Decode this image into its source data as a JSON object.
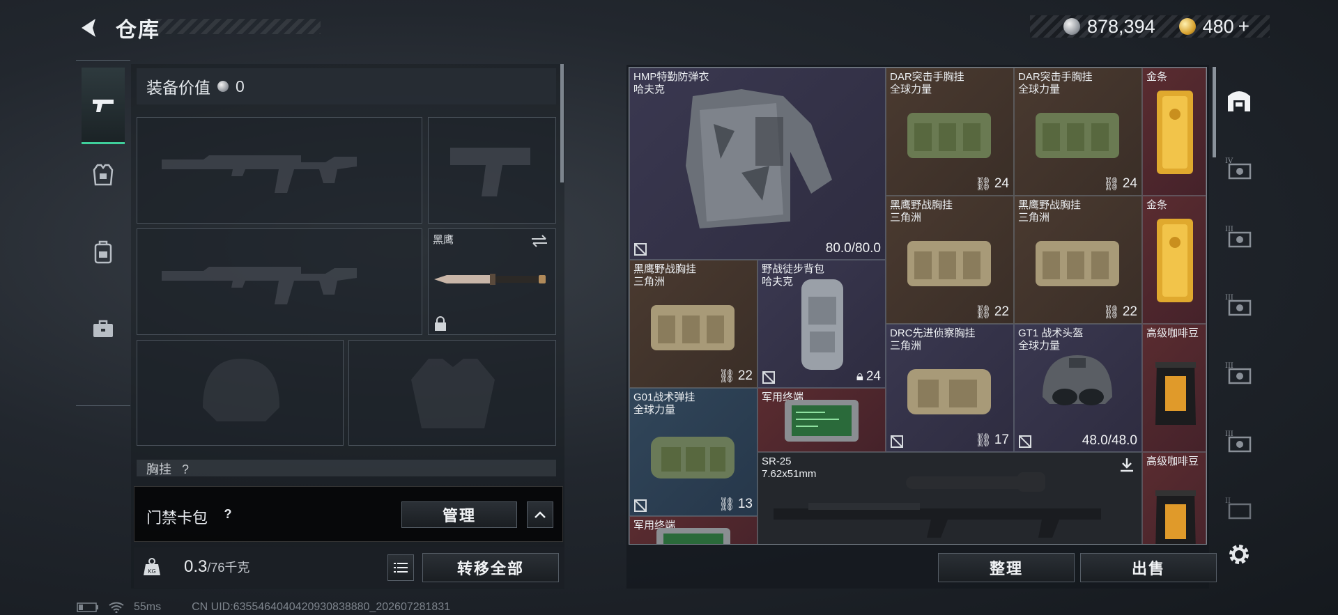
{
  "header": {
    "title": "仓库"
  },
  "currency": {
    "silver": "878,394",
    "gold": "480",
    "gold_plus": "+"
  },
  "equip": {
    "label": "装备价值",
    "value": "0"
  },
  "slots": {
    "melee_label": "黑鹰",
    "chest_label": "胸挂",
    "chest_q": "?"
  },
  "card_pack": {
    "label": "门禁卡包",
    "q": "?",
    "manage": "管理"
  },
  "weight": {
    "value": "0.3",
    "unit": "/76千克",
    "transfer_all": "转移全部"
  },
  "status": {
    "ping": "55ms",
    "uid": "CN UID:6355464040420930838880_202607281831"
  },
  "items": [
    {
      "name": "HMP特勤防弹衣",
      "sub": "哈夫克",
      "durability": "80.0/80.0"
    },
    {
      "name": "DAR突击手胸挂",
      "sub": "全球力量",
      "count": "24"
    },
    {
      "name": "DAR突击手胸挂",
      "sub": "全球力量",
      "count": "24"
    },
    {
      "name": "金条",
      "sub": ""
    },
    {
      "name": "黑鹰野战胸挂",
      "sub": "三角洲",
      "count": "22"
    },
    {
      "name": "黑鹰野战胸挂",
      "sub": "三角洲",
      "count": "22"
    },
    {
      "name": "金条",
      "sub": ""
    },
    {
      "name": "黑鹰野战胸挂",
      "sub": "三角洲",
      "count": "22"
    },
    {
      "name": "野战徒步背包",
      "sub": "哈夫克",
      "count": "24"
    },
    {
      "name": "DRC先进侦察胸挂",
      "sub": "三角洲",
      "count": "17"
    },
    {
      "name": "GT1 战术头盔",
      "sub": "全球力量",
      "durability": "48.0/48.0"
    },
    {
      "name": "高级咖啡豆",
      "sub": ""
    },
    {
      "name": "G01战术弹挂",
      "sub": "全球力量",
      "count": "13"
    },
    {
      "name": "军用终端",
      "sub": ""
    },
    {
      "name": "SR-25",
      "sub": "7.62x51mm"
    },
    {
      "name": "高级咖啡豆",
      "sub": ""
    },
    {
      "name": "军用终端",
      "sub": ""
    }
  ],
  "actions": {
    "sort": "整理",
    "sell": "出售"
  },
  "colors": {
    "accent_green": "#3fcf9b",
    "rarity_purple": "#3a3850",
    "rarity_red": "#5a2c30",
    "rarity_blue": "#31465a",
    "rarity_brown": "#4a3a30"
  }
}
